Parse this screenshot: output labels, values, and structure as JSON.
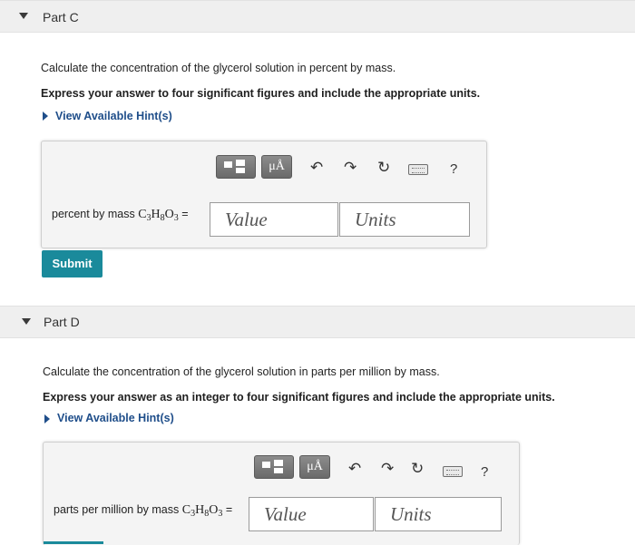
{
  "part_c": {
    "title": "Part C",
    "question": "Calculate the concentration of the glycerol solution in percent by mass.",
    "instruction": "Express your answer to four significant figures and include the appropriate units.",
    "hint_link": "View Available Hint(s)",
    "answer_label": "percent by mass",
    "formula": {
      "c": "C",
      "c_sub": "3",
      "h": "H",
      "h_sub": "8",
      "o": "O",
      "o_sub": "3"
    },
    "equals": "=",
    "value_placeholder": "Value",
    "units_placeholder": "Units",
    "submit_label": "Submit"
  },
  "part_d": {
    "title": "Part D",
    "question": "Calculate the concentration of the glycerol solution in parts per million by mass.",
    "instruction": "Express your answer as an integer to four significant figures and include the appropriate units.",
    "hint_link": "View Available Hint(s)",
    "answer_label": "parts per million by mass",
    "formula": {
      "c": "C",
      "c_sub": "3",
      "h": "H",
      "h_sub": "8",
      "o": "O",
      "o_sub": "3"
    },
    "equals": "=",
    "value_placeholder": "Value",
    "units_placeholder": "Units"
  },
  "toolbar": {
    "mu_label": "μÅ",
    "help_label": "?",
    "icons": [
      "templates-icon",
      "mu-angstrom-icon",
      "undo-icon",
      "redo-icon",
      "reset-icon",
      "keyboard-icon",
      "help-icon"
    ]
  },
  "colors": {
    "accent": "#1a8a9b",
    "hint": "#1f4e8a",
    "header_bg": "#efefef"
  }
}
